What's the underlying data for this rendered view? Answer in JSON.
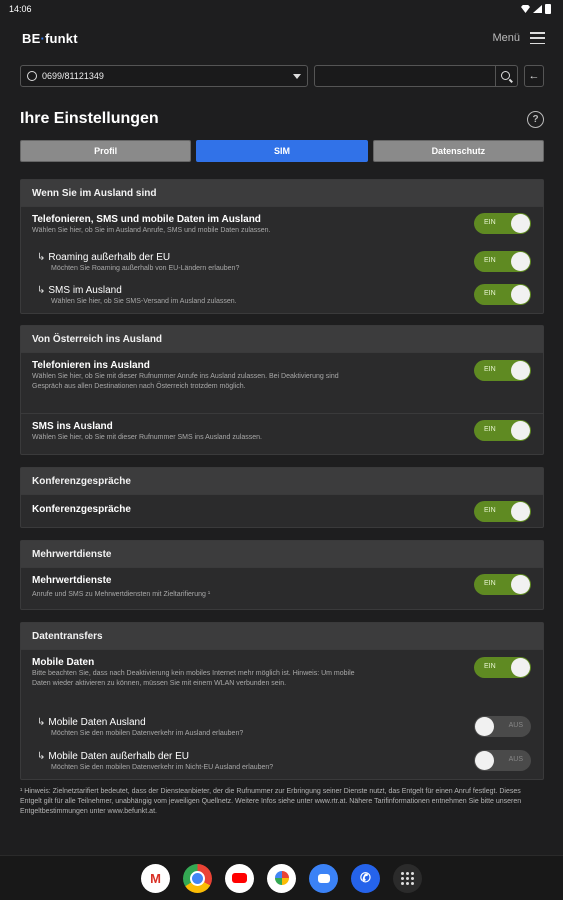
{
  "status_bar": {
    "time": "14:06"
  },
  "header": {
    "logo_text": "BE",
    "logo_dot": "·",
    "logo_suffix": "funkt",
    "menu_label": "Menü"
  },
  "toolbar": {
    "phone_number": "0699/81121349",
    "search_value": "",
    "back_symbol": "←"
  },
  "page": {
    "title": "Ihre Einstellungen",
    "help_symbol": "?"
  },
  "tabs": [
    {
      "label": "Profil",
      "active": false
    },
    {
      "label": "SIM",
      "active": true
    },
    {
      "label": "Datenschutz",
      "active": false
    }
  ],
  "sections": [
    {
      "title": "Wenn Sie im Ausland sind",
      "rows": [
        {
          "title": "Telefonieren, SMS und mobile Daten im Ausland",
          "desc": "Wählen Sie hier, ob Sie im Ausland Anrufe, SMS und mobile Daten zulassen.",
          "toggle": "EIN",
          "sub": false
        },
        {
          "title": "Roaming außerhalb der EU",
          "desc": "Möchten Sie Roaming außerhalb von EU-Ländern erlauben?",
          "toggle": "EIN",
          "sub": true
        },
        {
          "title": "SMS im Ausland",
          "desc": "Wählen Sie hier, ob Sie SMS-Versand im Ausland zulassen.",
          "toggle": "EIN",
          "sub": true
        }
      ]
    },
    {
      "title": "Von Österreich ins Ausland",
      "rows": [
        {
          "title": "Telefonieren ins Ausland",
          "desc": "Wählen Sie hier, ob Sie mit dieser Rufnummer Anrufe ins Ausland zulassen. Bei Deaktivierung sind Gespräch aus allen Destinationen nach Österreich trotzdem möglich.",
          "toggle": "EIN",
          "sub": false
        },
        {
          "title": "SMS ins Ausland",
          "desc": "Wählen Sie hier, ob Sie mit dieser Rufnummer SMS ins Ausland zulassen.",
          "toggle": "EIN",
          "sub": false
        }
      ]
    },
    {
      "title": "Konferenzgespräche",
      "rows": [
        {
          "title": "Konferenzgespräche",
          "desc": "",
          "toggle": "EIN",
          "sub": false
        }
      ]
    },
    {
      "title": "Mehrwertdienste",
      "rows": [
        {
          "title": "Mehrwertdienste",
          "desc": "Anrufe und SMS zu Mehrwertdiensten mit Zieltarifierung ¹",
          "toggle": "EIN",
          "sub": false
        }
      ]
    },
    {
      "title": "Datentransfers",
      "rows": [
        {
          "title": "Mobile Daten",
          "desc": "Bitte beachten Sie, dass nach Deaktivierung kein mobiles Internet mehr möglich ist. Hinweis: Um mobile Daten wieder aktivieren zu können, müssen Sie mit einem WLAN verbunden sein.",
          "toggle": "EIN",
          "sub": false
        },
        {
          "title": "Mobile Daten Ausland",
          "desc": "Möchten Sie den mobilen Datenverkehr im Ausland erlauben?",
          "toggle": "AUS",
          "sub": true
        },
        {
          "title": "Mobile Daten außerhalb der EU",
          "desc": "Möchten Sie den mobilen Datenverkehr im Nicht-EU Ausland erlauben?",
          "toggle": "AUS",
          "sub": true
        }
      ]
    }
  ],
  "footnote": "¹ Hinweis: Zielnetztarifiert bedeutet, dass der Diensteanbieter, der die Rufnummer zur Erbringung seiner Dienste nutzt, das Entgelt für einen Anruf festlegt. Dieses Entgelt gilt für alle Teilnehmer, unabhängig vom jeweiligen Quellnetz. Weitere Infos siehe unter www.rtr.at. Nähere Tarifinformationen entnehmen Sie bitte unseren Entgeltbestimmungen unter www.befunkt.at.",
  "dock": [
    "gmail-icon",
    "chrome-icon",
    "youtube-icon",
    "photos-icon",
    "messages-icon",
    "phone-icon",
    "app-drawer-icon"
  ]
}
